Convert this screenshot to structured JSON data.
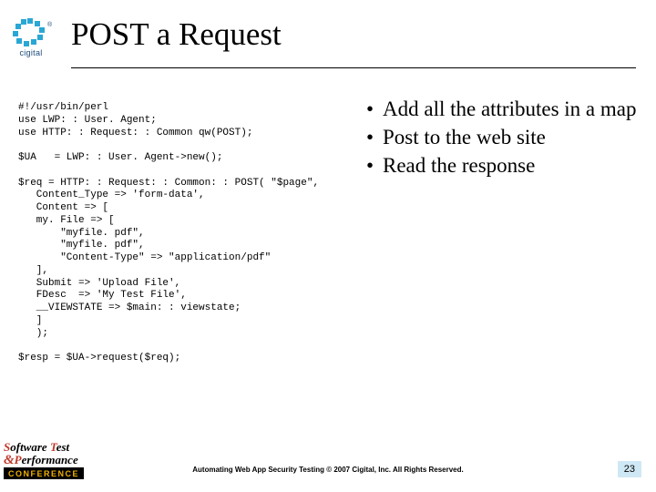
{
  "logo": {
    "brand": "cigital",
    "trademark": "®"
  },
  "title": "POST a Request",
  "code": "#!/usr/bin/perl\nuse LWP: : User. Agent;\nuse HTTP: : Request: : Common qw(POST);\n\n$UA   = LWP: : User. Agent->new();\n\n$req = HTTP: : Request: : Common: : POST( \"$page\",\n   Content_Type => 'form-data',\n   Content => [\n   my. File => [\n       \"myfile. pdf\",\n       \"myfile. pdf\",\n       \"Content-Type\" => \"application/pdf\"\n   ],\n   Submit => 'Upload File',\n   FDesc  => 'My Test File',\n   __VIEWSTATE => $main: : viewstate;\n   ]\n   );\n\n$resp = $UA->request($req);",
  "bullets": [
    "Add all the attributes in a map",
    "Post to the web site",
    "Read the response"
  ],
  "footer": "Automating Web App Security Testing  © 2007 Cigital, Inc. All Rights Reserved.",
  "page_number": "23",
  "footer_logo_lines": [
    "Software Test",
    "& Performance",
    "CONFERENCE"
  ]
}
